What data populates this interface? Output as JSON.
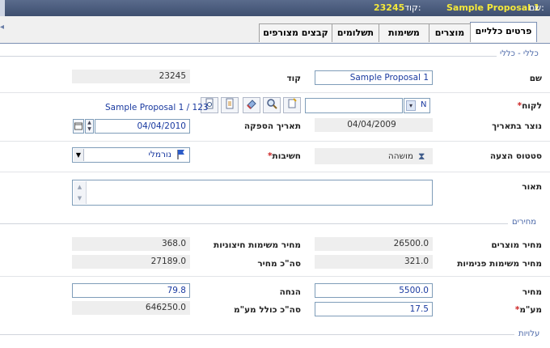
{
  "header": {
    "name_label": "שם:",
    "name_value": "Sample Proposal 1",
    "code_label": "קוד:",
    "code_value": "23245"
  },
  "tabs": [
    {
      "label": "פרטים כלליים",
      "active": true
    },
    {
      "label": "מוצרים",
      "active": false
    },
    {
      "label": "משימות",
      "active": false
    },
    {
      "label": "תשלומים",
      "active": false
    },
    {
      "label": "קבצים מצורפים",
      "active": false
    }
  ],
  "general": {
    "section_title": "כללי - כללי",
    "name_label": "שם",
    "name_value": "Sample Proposal 1",
    "code_label": "קוד",
    "code_value": "23245",
    "customer_label": "לקוח",
    "customer_required": "*",
    "customer_combo_text": "N",
    "customer_link": "Sample Proposal 1 / 123",
    "created_label": "נוצר בתאריך",
    "created_value": "04/04/2009",
    "supply_date_label": "תאריך הספקה",
    "supply_date_value": "04/04/2010",
    "status_label": "סטטוס הצעה",
    "status_value": "מושהה",
    "importance_label": "חשיבות",
    "importance_required": "*",
    "importance_value": "נורמלי",
    "description_label": "תאור",
    "description_value": ""
  },
  "prices": {
    "section_title": "מחירים",
    "products_price_label": "מחיר מוצרים",
    "products_price_value": "26500.0",
    "external_tasks_label": "מחיר משימות חיצוניות",
    "external_tasks_value": "368.0",
    "internal_tasks_label": "מחיר משימות פנימיות",
    "internal_tasks_value": "321.0",
    "total_price_label": "סה\"כ מחיר",
    "total_price_value": "27189.0",
    "price_label": "מחיר",
    "price_value": "5500.0",
    "discount_label": "הנחה",
    "discount_value": "79.8",
    "vat_label": "מע\"מ",
    "vat_required": "*",
    "vat_value": "17.5",
    "total_vat_label": "סה\"כ כולל מע\"מ",
    "total_vat_value": "646250.0"
  },
  "costs": {
    "section_title": "עלויות"
  },
  "colors": {
    "header_bg": "#4a5b7c",
    "header_text": "#f5e93a",
    "link": "#1a3aa0",
    "section_title": "#4a67a8",
    "required": "#cc2222"
  }
}
